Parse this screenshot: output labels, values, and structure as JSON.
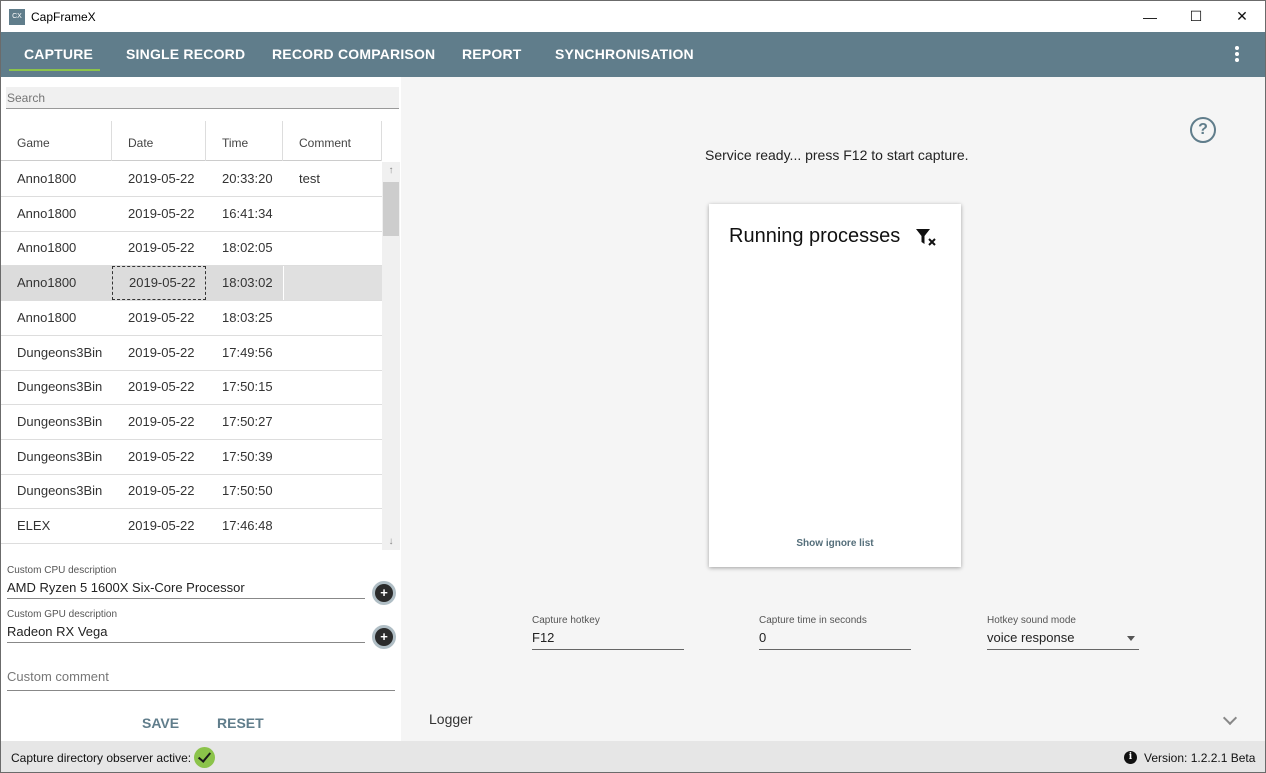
{
  "window": {
    "title": "CapFrameX",
    "icon_text": "CX",
    "controls": {
      "minimize": "—",
      "maximize": "☐",
      "close": "✕"
    }
  },
  "nav": {
    "tabs": [
      {
        "label": "CAPTURE",
        "active": true
      },
      {
        "label": "SINGLE RECORD",
        "active": false
      },
      {
        "label": "RECORD COMPARISON",
        "active": false
      },
      {
        "label": "REPORT",
        "active": false
      },
      {
        "label": "SYNCHRONISATION",
        "active": false
      }
    ]
  },
  "left": {
    "search_placeholder": "Search",
    "columns": [
      "Game",
      "Date",
      "Time",
      "Comment"
    ],
    "rows": [
      {
        "game": "Anno1800",
        "date": "2019-05-22",
        "time": "20:33:20",
        "comment": "test"
      },
      {
        "game": "Anno1800",
        "date": "2019-05-22",
        "time": "16:41:34",
        "comment": ""
      },
      {
        "game": "Anno1800",
        "date": "2019-05-22",
        "time": "18:02:05",
        "comment": ""
      },
      {
        "game": "Anno1800",
        "date": "2019-05-22",
        "time": "18:03:02",
        "comment": "",
        "selected": true
      },
      {
        "game": "Anno1800",
        "date": "2019-05-22",
        "time": "18:03:25",
        "comment": ""
      },
      {
        "game": "Dungeons3Bin",
        "date": "2019-05-22",
        "time": "17:49:56",
        "comment": ""
      },
      {
        "game": "Dungeons3Bin",
        "date": "2019-05-22",
        "time": "17:50:15",
        "comment": ""
      },
      {
        "game": "Dungeons3Bin",
        "date": "2019-05-22",
        "time": "17:50:27",
        "comment": ""
      },
      {
        "game": "Dungeons3Bin",
        "date": "2019-05-22",
        "time": "17:50:39",
        "comment": ""
      },
      {
        "game": "Dungeons3Bin",
        "date": "2019-05-22",
        "time": "17:50:50",
        "comment": ""
      },
      {
        "game": "ELEX",
        "date": "2019-05-22",
        "time": "17:46:48",
        "comment": ""
      }
    ],
    "cpu": {
      "label": "Custom CPU description",
      "value": "AMD Ryzen 5 1600X Six-Core Processor"
    },
    "gpu": {
      "label": "Custom GPU description",
      "value": "Radeon RX Vega"
    },
    "comment_placeholder": "Custom comment",
    "save_label": "SAVE",
    "reset_label": "RESET"
  },
  "right": {
    "status_message": "Service ready... press F12 to start capture.",
    "card": {
      "title": "Running processes",
      "ignore_link": "Show ignore list"
    },
    "hotkey": {
      "label": "Capture hotkey",
      "value": "F12"
    },
    "capture_time": {
      "label": "Capture time in seconds",
      "value": "0"
    },
    "sound_mode": {
      "label": "Hotkey sound mode",
      "value": "voice response"
    },
    "logger_label": "Logger"
  },
  "statusbar": {
    "observer_text": "Capture directory observer active:",
    "version_text": "Version:  1.2.2.1 Beta"
  },
  "colors": {
    "nav_bg": "#607d8b",
    "accent": "#8bc34a"
  }
}
